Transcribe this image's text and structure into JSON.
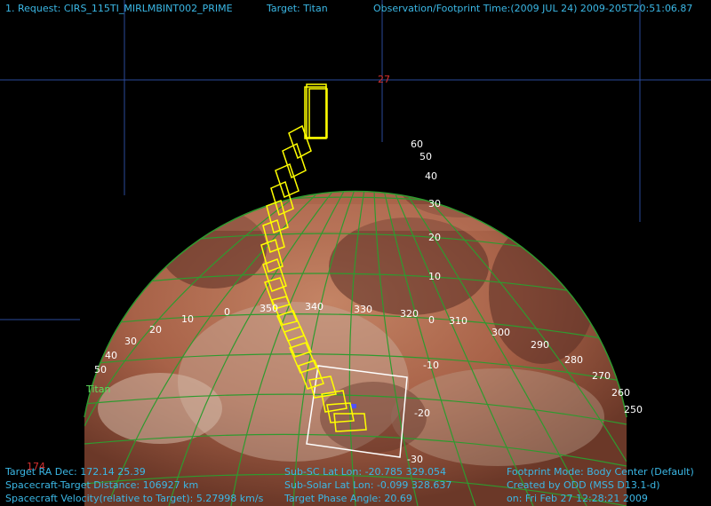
{
  "header": {
    "request": "1. Request: CIRS_115TI_MIRLMBINT002_PRIME",
    "target": "Target: Titan",
    "obs_time": "Observation/Footprint Time:(2009 JUL 24) 2009-205T20:51:06.87"
  },
  "body_label": "Titan",
  "grid_labels": {
    "top_ra": "27",
    "bottom_left": "174"
  },
  "latitude_labels": [
    "60",
    "50",
    "40",
    "30",
    "20",
    "10",
    "0",
    "-10",
    "-20",
    "-30"
  ],
  "left_latitude_labels": [
    "50",
    "40",
    "30",
    "20",
    "10"
  ],
  "longitude_labels": [
    "0",
    "350",
    "340",
    "330",
    "320",
    "310",
    "300",
    "290",
    "280",
    "270",
    "260",
    "250"
  ],
  "footer": {
    "left": [
      "Target RA Dec: 172.14  25.39",
      "Spacecraft-Target Distance: 106927 km",
      "Spacecraft Velocity(relative to Target): 5.27998 km/s"
    ],
    "middle": [
      "Sub-SC Lat Lon: -20.785  329.054",
      "Sub-Solar Lat Lon: -0.099  328.637",
      "Target Phase Angle: 20.69"
    ],
    "right": [
      "Footprint Mode: Body Center (Default)",
      "Created by ODD (MSS D13.1-d)",
      "on: Fri Feb 27 12:28:21 2009"
    ]
  },
  "colors": {
    "footprint": "#ffff00",
    "frame": "#ffffff",
    "grid_green": "#2f9a2f",
    "sky_grid": "#2a4a9a",
    "header_cyan": "#3bb8e6",
    "footer_green": "#5fe05f"
  }
}
